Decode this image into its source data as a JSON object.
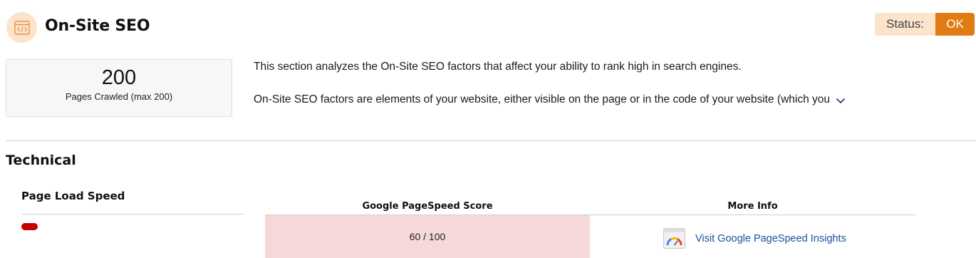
{
  "header": {
    "title": "On-Site SEO",
    "icon": "code-window-icon",
    "status_label": "Status:",
    "status_value": "OK",
    "status_color": "#e07a12"
  },
  "crawl": {
    "count": "200",
    "label": "Pages Crawled (max 200)"
  },
  "description": {
    "line1": "This section analyzes the On-Site SEO factors that affect your ability to rank high in search engines.",
    "line2": "On-Site SEO factors are elements of your website, either visible on the page or in the code of your website (which you"
  },
  "technical": {
    "title": "Technical",
    "page_load_speed": {
      "title": "Page Load Speed",
      "indicator_color": "#c40000",
      "columns": [
        "Google PageSpeed Score",
        "More Info"
      ],
      "score": "60 / 100",
      "link_label": "Visit Google PageSpeed Insights",
      "link_icon": "pagespeed-gauge-icon"
    }
  }
}
